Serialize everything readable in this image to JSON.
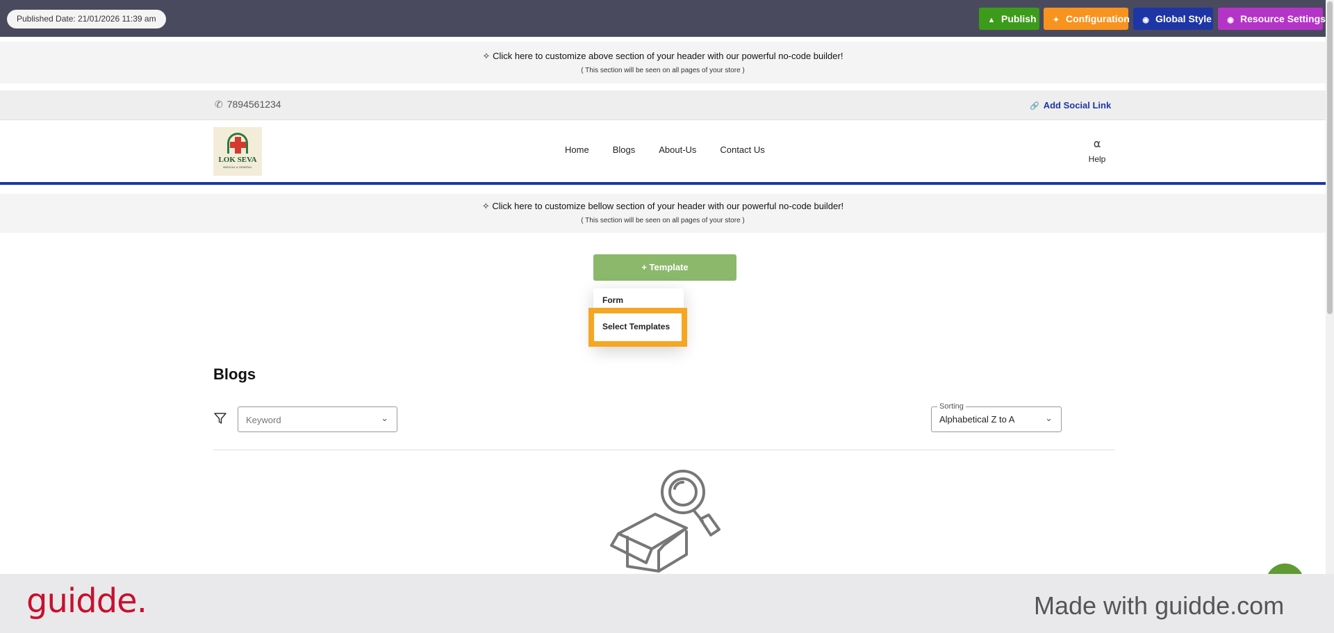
{
  "topbar": {
    "published_date": "Published Date: 21/01/2026 11:39 am",
    "buttons": [
      {
        "label": "Publish",
        "icon": "megaphone-icon",
        "color": "#3d9b1c"
      },
      {
        "label": "Configuration",
        "icon": "sparkle-icon",
        "color": "#f7931e"
      },
      {
        "label": "Global Style",
        "icon": "globe-icon",
        "color": "#1e35a6"
      },
      {
        "label": "Resource Settings",
        "icon": "globe-icon",
        "color": "#b534c8"
      }
    ]
  },
  "header_top_band": {
    "text": "Click here to customize above section of your header with our powerful no-code builder!",
    "subtext": "( This section will be seen on all pages of your store )"
  },
  "contact_bar": {
    "phone": "7894561234",
    "social_link": "Add Social Link"
  },
  "nav": {
    "logo_name": "LOK SEVA",
    "logo_tagline": "MEDICAL & GENERAL",
    "items": [
      "Home",
      "Blogs",
      "About-Us",
      "Contact Us"
    ],
    "help_label": "Help"
  },
  "header_bottom_band": {
    "text": "Click here to customize bellow section of your header with our powerful no-code builder!",
    "subtext": "( This section will be seen on all pages of your store )"
  },
  "template": {
    "button_label": "+ Template",
    "menu": [
      "Form",
      "Select Templates"
    ],
    "highlighted": "Select Templates",
    "highlight_color": "#f5a623"
  },
  "blogs": {
    "title": "Blogs",
    "keyword_placeholder": "Keyword",
    "sorting_label": "Sorting",
    "sorting_value": "Alphabetical Z to A"
  },
  "footer": {
    "brand": "guidde.",
    "made_with": "Made with guidde.com"
  }
}
